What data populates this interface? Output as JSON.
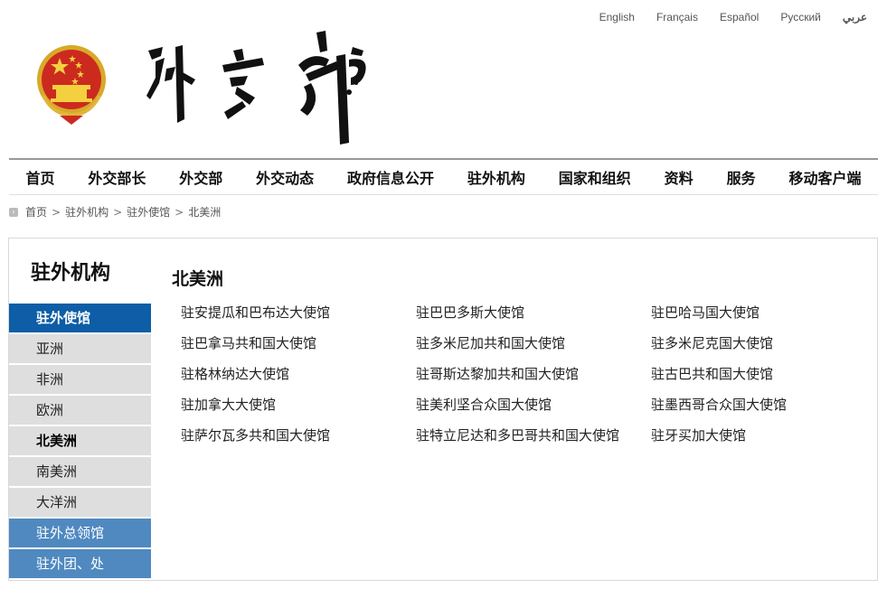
{
  "languages": [
    "English",
    "Français",
    "Español",
    "Русский",
    "عربي"
  ],
  "nav": [
    "首页",
    "外交部长",
    "外交部",
    "外交动态",
    "政府信息公开",
    "驻外机构",
    "国家和组织",
    "资料",
    "服务",
    "移动客户端"
  ],
  "breadcrumb": {
    "items": [
      "首页",
      "驻外机构",
      "驻外使馆",
      "北美洲"
    ],
    "separator": ">"
  },
  "sidebar": {
    "title": "驻外机构",
    "items": [
      {
        "label": "驻外使馆",
        "style": "primary"
      },
      {
        "label": "亚洲",
        "style": "sub"
      },
      {
        "label": "非洲",
        "style": "sub"
      },
      {
        "label": "欧洲",
        "style": "sub"
      },
      {
        "label": "北美洲",
        "style": "sub-active"
      },
      {
        "label": "南美洲",
        "style": "sub"
      },
      {
        "label": "大洋洲",
        "style": "sub"
      },
      {
        "label": "驻外总领馆",
        "style": "secondary"
      },
      {
        "label": "驻外团、处",
        "style": "secondary"
      }
    ]
  },
  "content": {
    "title": "北美洲",
    "embassies": [
      "驻安提瓜和巴布达大使馆",
      "驻巴巴多斯大使馆",
      "驻巴哈马国大使馆",
      "驻巴拿马共和国大使馆",
      "驻多米尼加共和国大使馆",
      "驻多米尼克国大使馆",
      "驻格林纳达大使馆",
      "驻哥斯达黎加共和国大使馆",
      "驻古巴共和国大使馆",
      "驻加拿大大使馆",
      "驻美利坚合众国大使馆",
      "驻墨西哥合众国大使馆",
      "驻萨尔瓦多共和国大使馆",
      "驻特立尼达和多巴哥共和国大使馆",
      "驻牙买加大使馆"
    ]
  },
  "colors": {
    "primary_blue": "#0d5ea6",
    "secondary_blue": "#4f89c0",
    "sub_gray": "#dedede"
  }
}
